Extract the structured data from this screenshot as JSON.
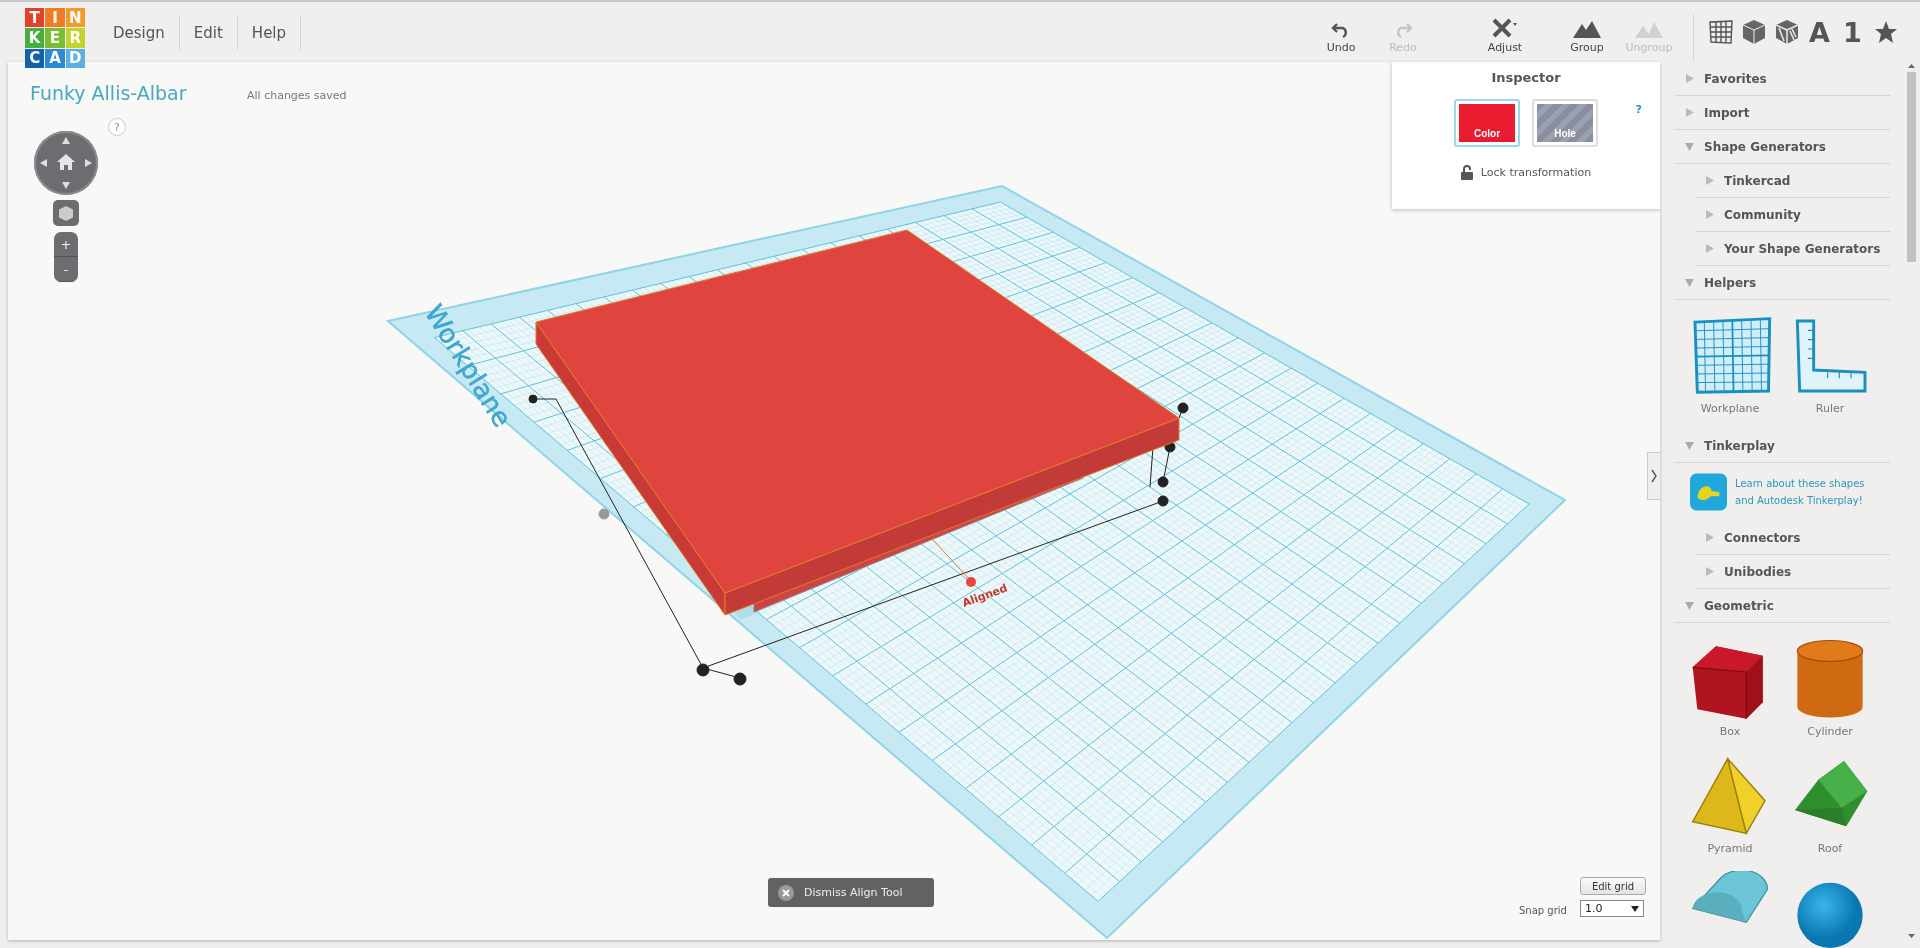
{
  "logo": {
    "letters": [
      "T",
      "I",
      "N",
      "K",
      "E",
      "R",
      "C",
      "A",
      "D"
    ]
  },
  "menu": [
    {
      "label": "Design"
    },
    {
      "label": "Edit"
    },
    {
      "label": "Help"
    }
  ],
  "toolbar": [
    {
      "kind": "undo",
      "label": "Undo",
      "disabled": false
    },
    {
      "kind": "redo",
      "label": "Redo",
      "disabled": true
    },
    {
      "kind": "adjust",
      "label": "Adjust",
      "disabled": false
    },
    {
      "kind": "group",
      "label": "Group",
      "disabled": false
    },
    {
      "kind": "ungroup",
      "label": "Ungroup",
      "disabled": true
    }
  ],
  "view_tabs": [
    {
      "kind": "grid"
    },
    {
      "kind": "cube"
    },
    {
      "kind": "hatched-cube"
    },
    {
      "kind": "text",
      "label": "A"
    },
    {
      "kind": "text",
      "label": "1"
    },
    {
      "kind": "star"
    }
  ],
  "design": {
    "title": "Funky Allis-Albar",
    "save_status": "All changes saved"
  },
  "navigation": {
    "help": "?",
    "zoom_in": "+",
    "zoom_out": "-"
  },
  "inspector": {
    "title": "Inspector",
    "help": "?",
    "options": [
      {
        "kind": "solid",
        "label": "Color",
        "selected": true
      },
      {
        "kind": "hole",
        "label": "Hole",
        "selected": false
      }
    ],
    "lock": {
      "label": "Lock transformation",
      "locked": false
    }
  },
  "workplane": {
    "label": "Workplane",
    "aligned_label": "Aligned"
  },
  "dismiss_button": "Dismiss Align Tool",
  "grid_controls": {
    "edit_button": "Edit grid",
    "snap_label": "Snap grid",
    "snap_value": "1.0"
  },
  "sidebar": {
    "sections": [
      {
        "title": "Favorites",
        "expanded": false
      },
      {
        "title": "Import",
        "expanded": false
      },
      {
        "title": "Shape Generators",
        "expanded": true,
        "children": [
          {
            "title": "Tinkercad",
            "expanded": false
          },
          {
            "title": "Community",
            "expanded": false
          },
          {
            "title": "Your Shape Generators",
            "expanded": false
          }
        ]
      },
      {
        "title": "Helpers",
        "expanded": true,
        "shapes": [
          {
            "kind": "workplane",
            "label": "Workplane"
          },
          {
            "kind": "ruler",
            "label": "Ruler"
          }
        ]
      },
      {
        "title": "Tinkerplay",
        "expanded": true,
        "promo": "Learn about these shapes and Autodesk Tinkerplay!",
        "children": [
          {
            "title": "Connectors",
            "expanded": false
          },
          {
            "title": "Unibodies",
            "expanded": false
          }
        ]
      },
      {
        "title": "Geometric",
        "expanded": true,
        "shapes": [
          {
            "kind": "box",
            "label": "Box"
          },
          {
            "kind": "cylinder",
            "label": "Cylinder"
          },
          {
            "kind": "pyramid",
            "label": "Pyramid"
          },
          {
            "kind": "roof",
            "label": "Roof"
          },
          {
            "kind": "half-cylinder"
          },
          {
            "kind": "sphere"
          }
        ]
      }
    ]
  }
}
